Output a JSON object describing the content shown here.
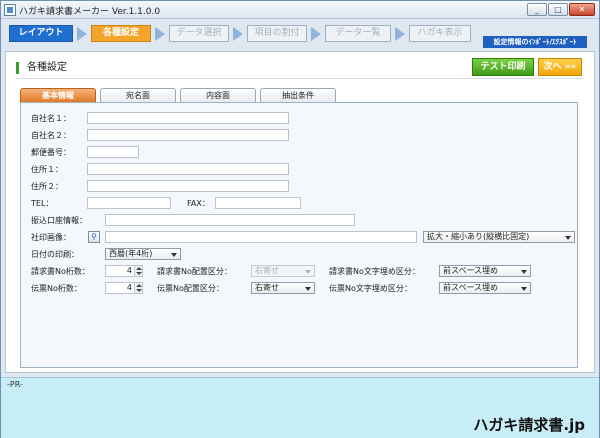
{
  "window": {
    "title": "ハガキ請求書メーカー Ver.1.1.0.0",
    "buttons": {
      "minimize": "_",
      "maximize": "□",
      "close": "✕"
    }
  },
  "steps": [
    {
      "label": "レイアウト"
    },
    {
      "label": "各種設定"
    },
    {
      "label": "データ選択"
    },
    {
      "label": "項目の割付"
    },
    {
      "label": "データ一覧"
    },
    {
      "label": "ハガキ表示"
    }
  ],
  "import_export_label": "設定情報のｲﾝﾎﾟｰﾄ/ｴｸｽﾎﾟｰﾄ",
  "section": {
    "title": "各種設定",
    "test_print": "テスト印刷",
    "next": "次へ »»"
  },
  "tabs": [
    {
      "label": "基本情報",
      "active": true
    },
    {
      "label": "宛名面"
    },
    {
      "label": "内容面"
    },
    {
      "label": "抽出条件"
    }
  ],
  "form": {
    "company1": {
      "label": "自社名１：",
      "value": ""
    },
    "company2": {
      "label": "自社名２：",
      "value": ""
    },
    "postal": {
      "label": "郵便番号：",
      "value": ""
    },
    "address1": {
      "label": "住所１：",
      "value": ""
    },
    "address2": {
      "label": "住所２：",
      "value": ""
    },
    "tel": {
      "label": "TEL：",
      "value": ""
    },
    "fax": {
      "label": "FAX：",
      "value": ""
    },
    "bank": {
      "label": "振込口座情報：",
      "value": ""
    },
    "stamp": {
      "label": "社印画像：",
      "value": "",
      "mode": "拡大・縮小あり(縦横比固定)"
    },
    "date_print": {
      "label": "日付の印刷：",
      "value": "西暦(年4桁)"
    },
    "invoice_digits": {
      "label": "請求書No桁数：",
      "value": "4"
    },
    "invoice_align": {
      "label": "請求書No配置区分：",
      "value": "右寄せ"
    },
    "invoice_fill": {
      "label": "請求書No文字埋め区分：",
      "value": "前スペース埋め"
    },
    "slip_digits": {
      "label": "伝票No桁数：",
      "value": "4"
    },
    "slip_align": {
      "label": "伝票No配置区分：",
      "value": "右寄せ"
    },
    "slip_fill": {
      "label": "伝票No文字埋め区分：",
      "value": "前スペース埋め"
    }
  },
  "footer": {
    "pr": "-PR-",
    "brand": "ハガキ請求書.jp"
  }
}
